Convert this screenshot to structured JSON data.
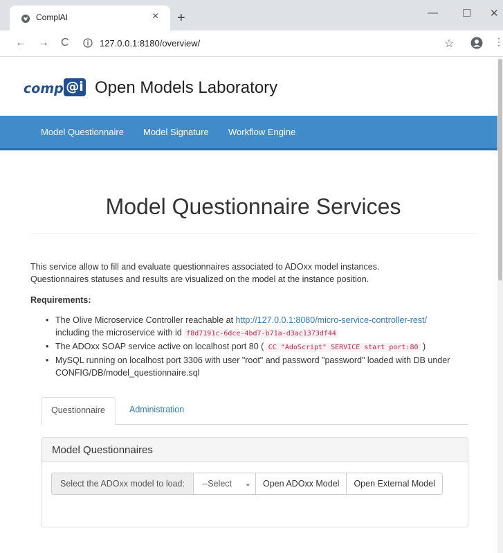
{
  "browser": {
    "tab_title": "ComplAI",
    "tab_close": "×",
    "new_tab": "+",
    "url": "127.0.0.1:8180/overview/",
    "minimize": "—",
    "maximize": "☐",
    "close": "✕",
    "back": "←",
    "forward": "→",
    "reload": "C",
    "star": "☆",
    "menu": "⋮"
  },
  "brand": {
    "logo_text_left": "compl",
    "logo_text_box": "@i",
    "site_title": "Open Models Laboratory"
  },
  "nav": {
    "items": [
      "Model Questionnaire",
      "Model Signature",
      "Workflow Engine"
    ]
  },
  "main": {
    "heading": "Model Questionnaire Services",
    "intro_line1": "This service allow to fill and evaluate questionnaires associated to ADOxx model instances.",
    "intro_line2": "Questionnaires statuses and results are visualized on the model at the instance position.",
    "requirements_title": "Requirements:",
    "req1_prefix": "The Olive Microservice Controller reachable at ",
    "req1_link": "http://127.0.0.1:8080/micro-service-controller-rest/",
    "req1_mid": "including the microservice with id ",
    "req1_code": "f8d7191c-6dce-4bd7-b71a-d3ac1373df44",
    "req2_prefix": "The ADOxx SOAP service active on localhost port 80 ( ",
    "req2_code": "CC \"AdoScript\" SERVICE start port:80",
    "req2_suffix": " )",
    "req3_line1": "MySQL running on localhost port 3306 with user \"root\" and password \"password\" loaded with DB under",
    "req3_line2": "CONFIG/DB/model_questionnaire.sql"
  },
  "tabs": {
    "active": "Questionnaire",
    "inactive": "Administration"
  },
  "panel": {
    "heading": "Model Questionnaires",
    "select_label": "Select the ADOxx model to load:",
    "select_value": "--Select",
    "open_adoxx": "Open ADOxx Model",
    "open_external": "Open External Model"
  }
}
